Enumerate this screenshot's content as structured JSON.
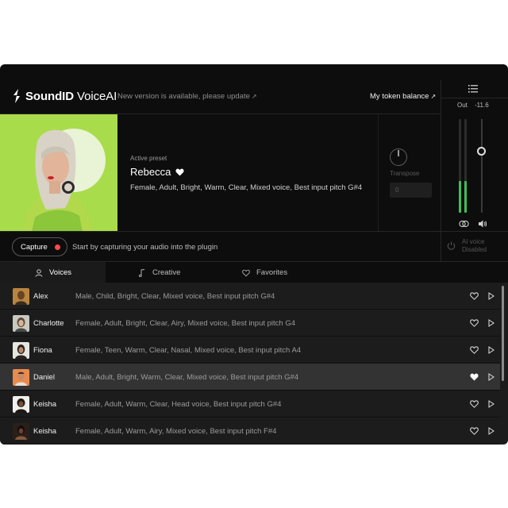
{
  "header": {
    "brand_bold": "SoundID",
    "brand_rest": " VoiceAI",
    "update_note": "New version is available, please update",
    "token_label": "My token balance"
  },
  "meter": {
    "out_label": "Out",
    "out_value": "-11.6",
    "left_level": 0.34,
    "right_level": 0.34
  },
  "preset": {
    "label": "Active preset",
    "name": "Rebecca",
    "favorited": true,
    "tags": "Female, Adult, Bright, Warm, Clear, Mixed voice, Best input pitch  G#4",
    "transpose_label": "Transpose",
    "transpose_value": "0"
  },
  "capture": {
    "button_label": "Capture",
    "hint": "Start by capturing your audio into the plugin",
    "ai_voice_label": "AI voice",
    "ai_voice_state": "Disabled"
  },
  "tabs": [
    {
      "label": "Voices",
      "icon": "person-icon",
      "active": true
    },
    {
      "label": "Creative",
      "icon": "music-note-icon",
      "active": false
    },
    {
      "label": "Favorites",
      "icon": "heart-outline-icon",
      "active": false
    }
  ],
  "voices": [
    {
      "name": "Alex",
      "tags": "Male, Child, Bright, Clear, Mixed voice, Best input pitch G#4",
      "favorited": false,
      "selected": false,
      "avatar_color": "#b8853f"
    },
    {
      "name": "Charlotte",
      "tags": "Female, Adult, Bright, Clear, Airy, Mixed voice, Best input pitch  G4",
      "favorited": false,
      "selected": false,
      "avatar_color": "#c9c9c0"
    },
    {
      "name": "Fiona",
      "tags": "Female, Teen, Warm, Clear, Nasal, Mixed voice, Best input pitch  A4",
      "favorited": false,
      "selected": false,
      "avatar_color": "#e6e6e0"
    },
    {
      "name": "Daniel",
      "tags": "Male, Adult, Bright, Warm, Clear, Mixed voice, Best input pitch  G#4",
      "favorited": true,
      "selected": true,
      "avatar_color": "#e98a4e"
    },
    {
      "name": "Keisha",
      "tags": "Female, Adult, Warm, Clear, Head voice, Best input pitch  G#4",
      "favorited": false,
      "selected": false,
      "avatar_color": "#f0f0ec"
    },
    {
      "name": "Keisha",
      "tags": "Female, Adult, Warm, Airy, Mixed voice, Best input pitch  F#4",
      "favorited": false,
      "selected": false,
      "avatar_color": "#2a1f1a"
    }
  ],
  "colors": {
    "background": "#0d0d0d",
    "accent_green": "#a6d94a",
    "meter_green": "#3fbf5a",
    "record_red": "#ff4a4a"
  }
}
